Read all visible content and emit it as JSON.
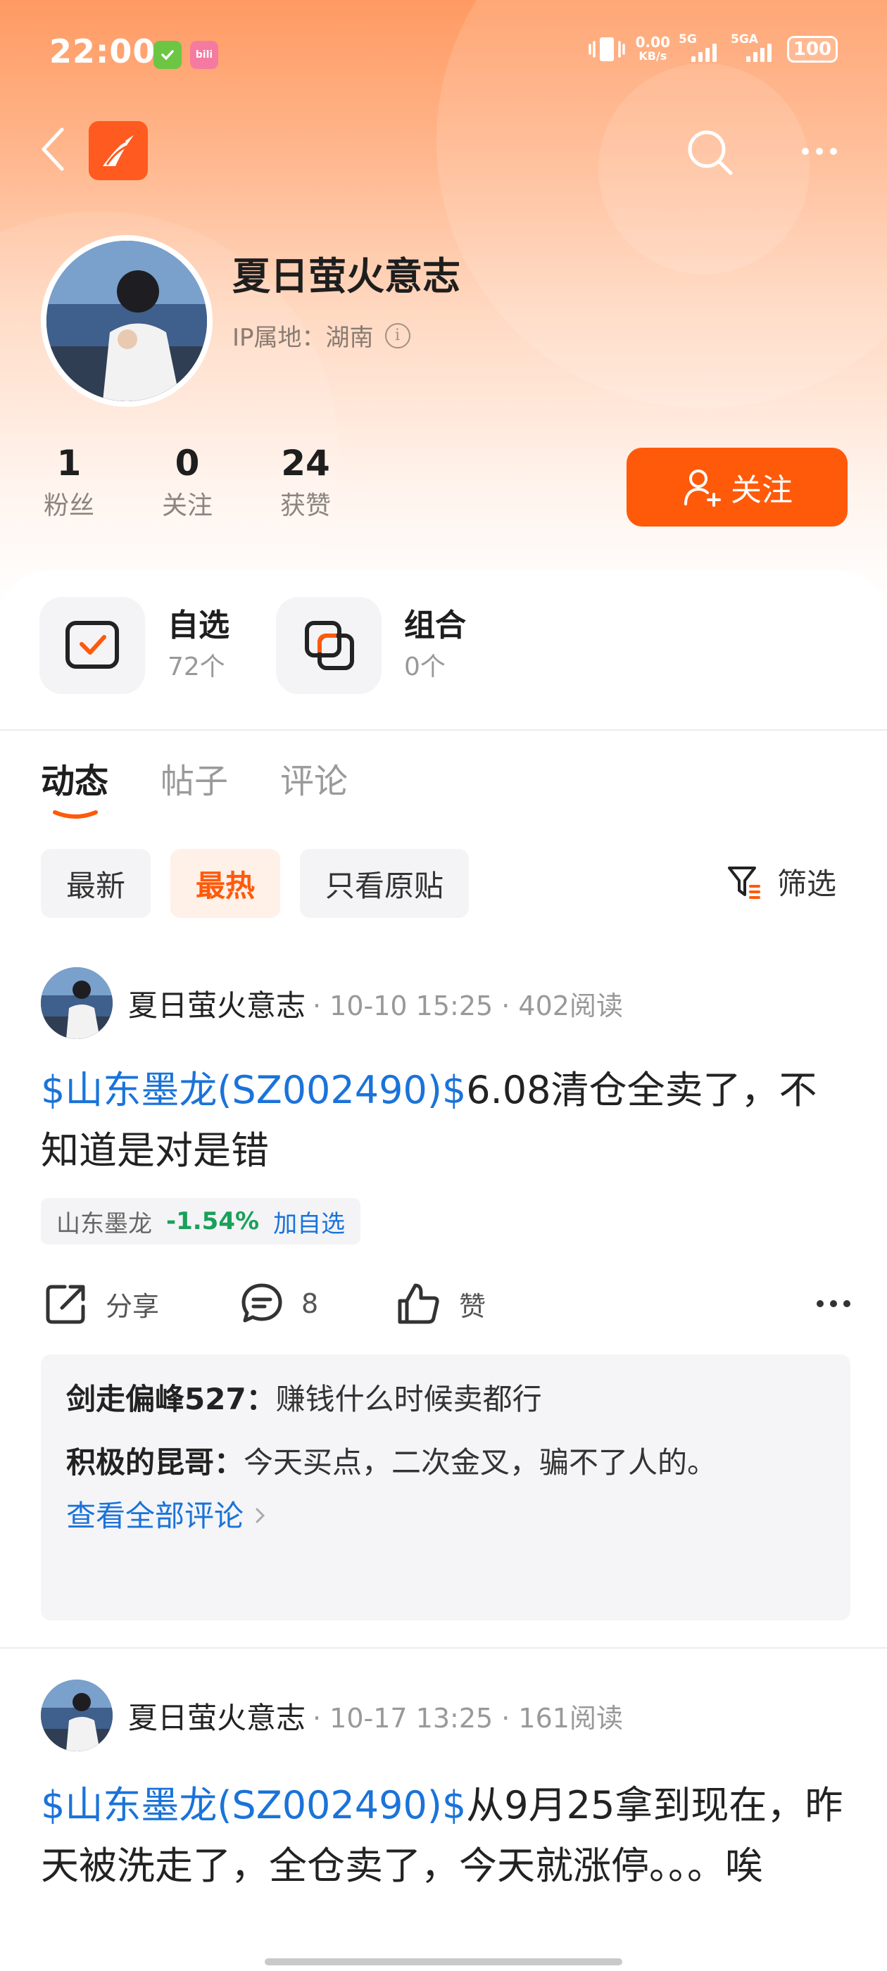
{
  "status_bar": {
    "time": "22:00",
    "net_speed_value": "0.00",
    "net_speed_unit": "KB/s",
    "signal1_label": "5G",
    "signal2_label": "5GA",
    "battery": "100"
  },
  "profile": {
    "username": "夏日萤火意志",
    "ip_label": "IP属地：湖南",
    "stats": [
      {
        "num": "1",
        "label": "粉丝"
      },
      {
        "num": "0",
        "label": "关注"
      },
      {
        "num": "24",
        "label": "获赞"
      }
    ],
    "follow_label": "关注"
  },
  "quick_links": [
    {
      "title": "自选",
      "sub": "72个"
    },
    {
      "title": "组合",
      "sub": "0个"
    }
  ],
  "tabs": [
    {
      "label": "动态"
    },
    {
      "label": "帖子"
    },
    {
      "label": "评论"
    }
  ],
  "chips": [
    {
      "label": "最新"
    },
    {
      "label": "最热"
    },
    {
      "label": "只看原贴"
    }
  ],
  "filter_label": "筛选",
  "colors": {
    "accent": "#ff5a0a",
    "link": "#1a73d9",
    "down": "#1aa05a"
  },
  "posts": [
    {
      "author": "夏日萤火意志",
      "meta": "· 10-10 15:25 · 402阅读",
      "stock": "$山东墨龙(SZ002490)$",
      "text": "6.08清仓全卖了，不知道是对是错",
      "tag": {
        "name": "山东墨龙",
        "change": "-1.54%",
        "add": "加自选"
      },
      "actions": {
        "share": "分享",
        "comments": "8",
        "like": "赞"
      },
      "comments": [
        {
          "user": "剑走偏峰527：",
          "text": "赚钱什么时候卖都行"
        },
        {
          "user": "积极的昆哥：",
          "text": "今天买点，二次金叉，骗不了人的。"
        }
      ],
      "view_all": "查看全部评论"
    },
    {
      "author": "夏日萤火意志",
      "meta": "· 10-17 13:25 · 161阅读",
      "stock": "$山东墨龙(SZ002490)$",
      "text": "从9月25拿到现在，昨天被洗走了，全仓卖了，今天就涨停。。。唉"
    }
  ]
}
